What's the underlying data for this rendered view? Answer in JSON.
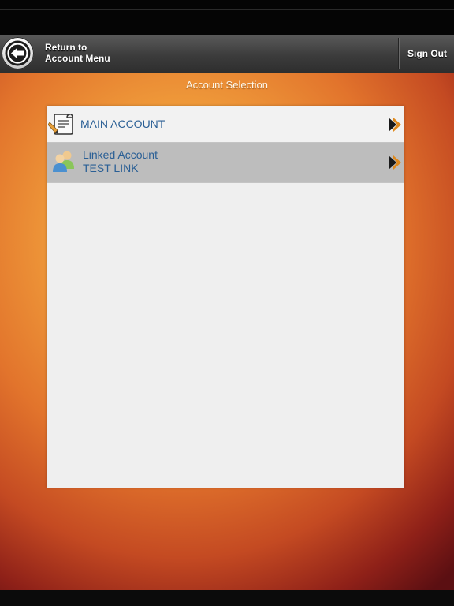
{
  "navbar": {
    "back_label_line1": "Return to",
    "back_label_line2": "Account Menu",
    "signout_label": "Sign Out"
  },
  "page": {
    "title": "Account Selection"
  },
  "accounts": [
    {
      "label": "MAIN ACCOUNT",
      "icon": "document-pen-icon"
    },
    {
      "label_line1": "Linked Account",
      "label_line2": "TEST LINK",
      "icon": "users-icon"
    }
  ],
  "colors": {
    "link_text": "#2a5f95",
    "chevron": "#e08a1e",
    "navbar": "#3c3c3c"
  }
}
